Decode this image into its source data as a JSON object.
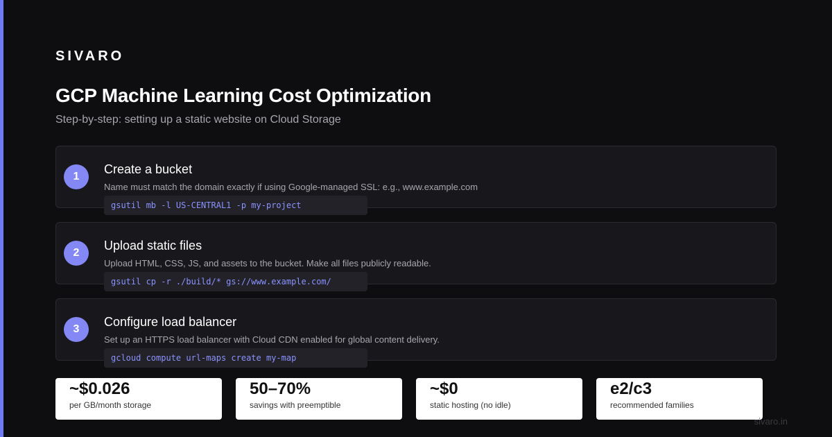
{
  "brand": "SIVARO",
  "title": "GCP Machine Learning Cost Optimization",
  "subtitle": "Step-by-step: setting up a static website on Cloud Storage",
  "steps": [
    {
      "number": "1",
      "title": "Create a bucket",
      "description": "Name must match the domain exactly if using Google-managed SSL: e.g., www.example.com",
      "command": "gsutil mb -l US-CENTRAL1 -p my-project"
    },
    {
      "number": "2",
      "title": "Upload static files",
      "description": "Upload HTML, CSS, JS, and assets to the bucket. Make all files publicly readable.",
      "command": "gsutil cp -r ./build/* gs://www.example.com/"
    },
    {
      "number": "3",
      "title": "Configure load balancer",
      "description": "Set up an HTTPS load balancer with Cloud CDN enabled for global content delivery.",
      "command": "gcloud compute url-maps create my-map"
    }
  ],
  "stats": [
    {
      "value": "~$0.026",
      "label": "per GB/month storage"
    },
    {
      "value": "50–70%",
      "label": "savings with preemptible"
    },
    {
      "value": "~$0",
      "label": "static hosting (no idle)"
    },
    {
      "value": "e2/c3",
      "label": "recommended families"
    }
  ],
  "footer": {
    "url": "sivaro.in"
  },
  "colors": {
    "background": "#0e0e10",
    "accent": "#6f7cf4",
    "step_badge": "#8388f5",
    "code_text": "#8b93ff",
    "card": "#18181c",
    "stat_card": "#ffffff"
  }
}
